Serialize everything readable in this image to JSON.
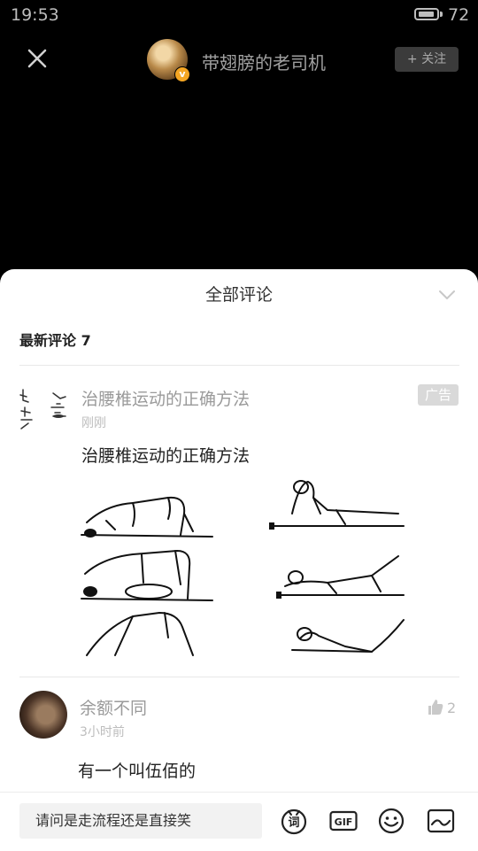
{
  "status_bar": {
    "time": "19:53",
    "battery": "72"
  },
  "header": {
    "username": "带翅膀的老司机",
    "follow_label": "+ 关注",
    "verified_badge": "v"
  },
  "sheet": {
    "title": "全部评论",
    "section_heading": "最新评论 7"
  },
  "ad": {
    "title": "治腰椎运动的正确方法",
    "time": "刚刚",
    "badge": "广告",
    "body": "治腰椎运动的正确方法",
    "image_icon": "exercise-illustration"
  },
  "comment": {
    "username": "余额不同",
    "time": "3小时前",
    "like_count": "2",
    "text": "有一个叫伍佰的"
  },
  "composer": {
    "input_value": "请问是走流程还是直接笑",
    "tools": [
      "word-icon",
      "gif-icon",
      "emoji-icon",
      "image-icon"
    ],
    "word_label": "词",
    "gif_label": "GIF"
  }
}
